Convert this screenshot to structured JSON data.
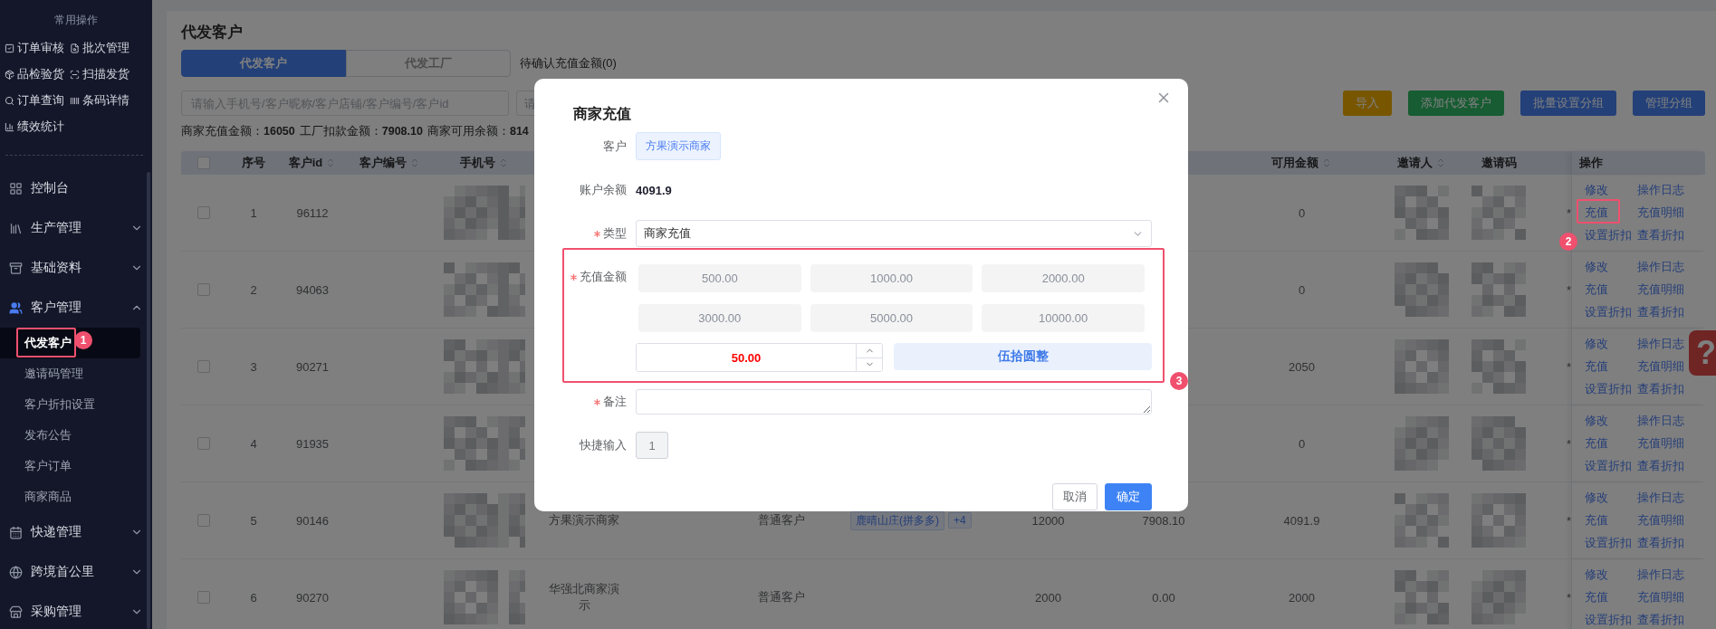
{
  "sidebar": {
    "quick_title": "常用操作",
    "quick_actions": [
      {
        "label": "订单审核"
      },
      {
        "label": "批次管理"
      },
      {
        "label": "品检验货"
      },
      {
        "label": "扫描发货"
      },
      {
        "label": "订单查询"
      },
      {
        "label": "条码详情"
      },
      {
        "label": "绩效统计"
      }
    ],
    "menu": [
      {
        "label": "控制台",
        "kind": "link"
      },
      {
        "label": "生产管理",
        "kind": "group",
        "expanded": false
      },
      {
        "label": "基础资料",
        "kind": "group",
        "expanded": false
      },
      {
        "label": "客户管理",
        "kind": "group",
        "expanded": true,
        "children": [
          {
            "label": "代发客户",
            "selected": true,
            "callout": "1"
          },
          {
            "label": "邀请码管理",
            "selected": false
          },
          {
            "label": "客户折扣设置",
            "selected": false
          },
          {
            "label": "发布公告",
            "selected": false
          },
          {
            "label": "客户订单",
            "selected": false
          },
          {
            "label": "商家商品",
            "selected": false
          }
        ]
      },
      {
        "label": "快递管理",
        "kind": "group",
        "expanded": false
      },
      {
        "label": "跨境首公里",
        "kind": "group",
        "expanded": false
      },
      {
        "label": "采购管理",
        "kind": "group",
        "expanded": false
      }
    ]
  },
  "page": {
    "title": "代发客户",
    "tabs": [
      {
        "label": "代发客户",
        "selected": true
      },
      {
        "label": "代发工厂",
        "selected": false
      }
    ],
    "pending_note": "待确认充值金额(0)",
    "search_fields": [
      {
        "placeholder": "请输入手机号/客户昵称/客户店铺/客户编号/客户id"
      },
      {
        "placeholder": "请"
      }
    ],
    "toolbar_buttons": [
      {
        "label": "导入",
        "kind": "warning"
      },
      {
        "label": "添加代发客户",
        "kind": "success"
      },
      {
        "label": "批量设置分组",
        "kind": "primary"
      },
      {
        "label": "管理分组",
        "kind": "primary"
      }
    ],
    "stats": [
      {
        "label": "商家充值金额：",
        "value": "16050"
      },
      {
        "label": "工厂扣款金额：",
        "value": "7908.10"
      },
      {
        "label": "商家可用余额：",
        "value": "814"
      }
    ]
  },
  "table": {
    "columns": [
      {
        "kind": "checkbox",
        "checked": false
      },
      {
        "kind": "text",
        "label": "序号",
        "sortable": false
      },
      {
        "kind": "text",
        "label": "客户id",
        "sortable": true
      },
      {
        "kind": "text",
        "label": "客户编号",
        "sortable": true
      },
      {
        "kind": "text",
        "label": "手机号",
        "sortable": true
      },
      {
        "kind": "text",
        "label": "可用金额",
        "sortable": true
      },
      {
        "kind": "text",
        "label": "邀请人",
        "sortable": true
      },
      {
        "kind": "text",
        "label": "邀请码",
        "sortable": false
      },
      {
        "kind": "text",
        "label": "操作",
        "sortable": false
      }
    ],
    "rows": [
      {
        "checked": false,
        "no": "1",
        "customer_id": "96112",
        "phone": {
          "kind": "redacted"
        },
        "available": "0",
        "inviter": {
          "kind": "redacted"
        },
        "invite_code": {
          "kind": "redacted"
        },
        "column_15": "*",
        "actions": [
          {
            "label": "修改"
          },
          {
            "label": "操作日志"
          },
          {
            "label": "充值",
            "callout": "2"
          },
          {
            "label": "充值明细"
          },
          {
            "label": "设置折扣"
          },
          {
            "label": "查看折扣"
          }
        ]
      },
      {
        "checked": false,
        "no": "2",
        "customer_id": "94063",
        "phone": {
          "kind": "redacted"
        },
        "available": "0",
        "inviter": {
          "kind": "redacted"
        },
        "invite_code": {
          "kind": "redacted"
        },
        "column_15": "*",
        "actions": [
          {
            "label": "修改"
          },
          {
            "label": "操作日志"
          },
          {
            "label": "充值"
          },
          {
            "label": "充值明细"
          },
          {
            "label": "设置折扣"
          },
          {
            "label": "查看折扣"
          }
        ]
      },
      {
        "checked": false,
        "no": "3",
        "customer_id": "90271",
        "phone": {
          "kind": "redacted"
        },
        "available": "2050",
        "inviter": {
          "kind": "redacted"
        },
        "invite_code": {
          "kind": "redacted"
        },
        "column_15": "*",
        "actions": [
          {
            "label": "修改"
          },
          {
            "label": "操作日志"
          },
          {
            "label": "充值"
          },
          {
            "label": "充值明细"
          },
          {
            "label": "设置折扣"
          },
          {
            "label": "查看折扣"
          }
        ]
      },
      {
        "checked": false,
        "no": "4",
        "customer_id": "91935",
        "phone": {
          "kind": "redacted"
        },
        "available": "0",
        "inviter": {
          "kind": "redacted"
        },
        "invite_code": {
          "kind": "redacted"
        },
        "column_15": "*",
        "actions": [
          {
            "label": "修改"
          },
          {
            "label": "操作日志"
          },
          {
            "label": "充值"
          },
          {
            "label": "充值明细"
          },
          {
            "label": "设置折扣"
          },
          {
            "label": "查看折扣"
          }
        ]
      },
      {
        "checked": false,
        "no": "5",
        "customer_id": "90146",
        "phone": {
          "kind": "redacted"
        },
        "column_6": "方果演示商家",
        "column_8": "普通客户",
        "column_9": [
          "鹿晴山庄(拼多多)",
          "+4"
        ],
        "column_10": "12000",
        "column_11": "7908.10",
        "available": "4091.9",
        "inviter": {
          "kind": "redacted"
        },
        "invite_code": {
          "kind": "redacted"
        },
        "column_15": "*",
        "actions": [
          {
            "label": "修改"
          },
          {
            "label": "操作日志"
          },
          {
            "label": "充值"
          },
          {
            "label": "充值明细"
          },
          {
            "label": "设置折扣"
          },
          {
            "label": "查看折扣"
          }
        ]
      },
      {
        "checked": false,
        "no": "6",
        "customer_id": "90270",
        "phone": {
          "kind": "redacted"
        },
        "column_6": "华强北商家演示",
        "column_8": "普通客户",
        "column_10": "2000",
        "column_11": "0.00",
        "available": "2000",
        "inviter": {
          "kind": "redacted"
        },
        "invite_code": {
          "kind": "redacted"
        },
        "column_15": "*",
        "actions": [
          {
            "label": "修改"
          },
          {
            "label": "操作日志"
          },
          {
            "label": "充值"
          },
          {
            "label": "充值明细"
          },
          {
            "label": "设置折扣"
          },
          {
            "label": "查看折扣"
          }
        ]
      }
    ]
  },
  "help_button": "?",
  "dialog": {
    "title": "商家充值",
    "fields": [
      {
        "kind": "tag",
        "label": "客户",
        "required": false,
        "value": "方果演示商家"
      },
      {
        "kind": "text",
        "label": "账户余额",
        "required": false,
        "value": "4091.9"
      },
      {
        "kind": "select",
        "label": "类型",
        "required": true,
        "value": "商家充值"
      },
      {
        "kind": "amount",
        "label": "充值金额",
        "required": true,
        "presets": [
          "500.00",
          "1000.00",
          "2000.00",
          "3000.00",
          "5000.00",
          "10000.00"
        ],
        "value": "50.00",
        "in_words": "伍拾圆整",
        "callout": "3"
      },
      {
        "kind": "textarea",
        "label": "备注",
        "required": true
      },
      {
        "kind": "chip",
        "label": "快捷输入",
        "required": false,
        "value": "1"
      }
    ],
    "buttons": [
      {
        "label": "取消",
        "kind": "default"
      },
      {
        "label": "确定",
        "kind": "primary"
      }
    ]
  }
}
